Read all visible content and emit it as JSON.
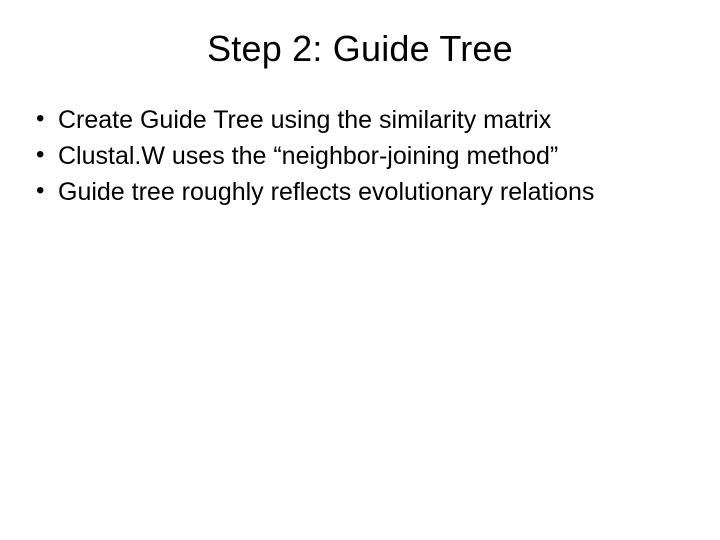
{
  "slide": {
    "title": "Step 2: Guide Tree",
    "bullets": [
      "Create Guide Tree using the similarity matrix",
      "Clustal.W uses the “neighbor-joining method”",
      "Guide tree roughly reflects evolutionary relations"
    ]
  }
}
